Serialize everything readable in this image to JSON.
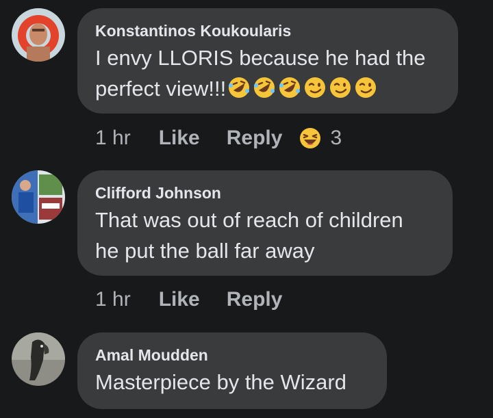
{
  "comments": [
    {
      "author": "Konstantinos Koukoularis",
      "text_line1": "I envy LLORIS because he had the",
      "text_line2": "perfect view!!!",
      "emojis": [
        "rolling-on-floor-laughing",
        "rolling-on-floor-laughing",
        "rolling-on-floor-laughing",
        "winking-face",
        "winking-face",
        "winking-face"
      ],
      "time": "1 hr",
      "like_label": "Like",
      "reply_label": "Reply",
      "reaction_icon": "laughing-reaction",
      "reaction_count": "3"
    },
    {
      "author": "Clifford Johnson",
      "text_line1": "That was out of reach of children",
      "text_line2": "he put the ball far away",
      "time": "1 hr",
      "like_label": "Like",
      "reply_label": "Reply"
    },
    {
      "author": "Amal Moudden",
      "text_line1": "Masterpiece by the Wizard"
    }
  ],
  "colors": {
    "background": "#18191a",
    "bubble": "#3a3b3c",
    "text": "#e4e6eb",
    "secondary_text": "#b0b3b8",
    "emoji_yellow": "#f7c53a"
  }
}
